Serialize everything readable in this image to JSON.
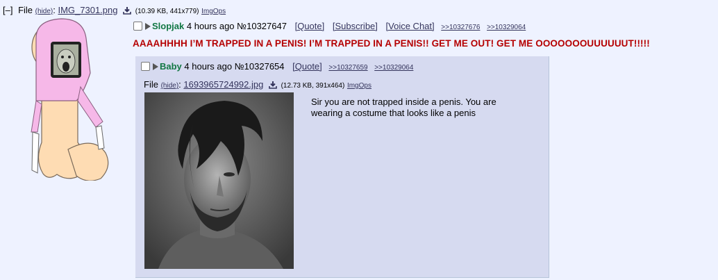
{
  "op": {
    "file": {
      "toggle": "[–]",
      "label": "File",
      "hide": "(hide)",
      "filename": "IMG_7301.png",
      "info": "(10.39 KB, 441x779)",
      "imgops": "ImgOps"
    },
    "post": {
      "name": "Slopjak",
      "time": "4 hours ago",
      "number": "№10327647",
      "quote_btn": "[Quote]",
      "subscribe_btn": "[Subscribe]",
      "voice_btn": "[Voice Chat]",
      "backlinks": [
        ">>10327676",
        ">>10329064"
      ]
    },
    "message": "AAAAHHHH I’M TRAPPED IN A PENIS! I’M TRAPPED IN A PENIS!! GET ME OUT! GET ME OOOOOOOUUUUUUT!!!!!"
  },
  "reply": {
    "post": {
      "name": "Baby",
      "time": "4 hours ago",
      "number": "№10327654",
      "quote_btn": "[Quote]",
      "backlinks": [
        ">>10327659",
        ">>10329064"
      ]
    },
    "file": {
      "label": "File",
      "hide": "(hide)",
      "filename": "1693965724992.jpg",
      "info": "(12.73 KB, 391x464)",
      "imgops": "ImgOps"
    },
    "message": "Sir you are not trapped inside a penis. You are wearing a costume that looks like a penis"
  },
  "colors": {
    "background": "#eef2ff",
    "reply_bg": "#d6daf0",
    "name": "#117743",
    "op_text": "#b50000",
    "link": "#34345c"
  }
}
